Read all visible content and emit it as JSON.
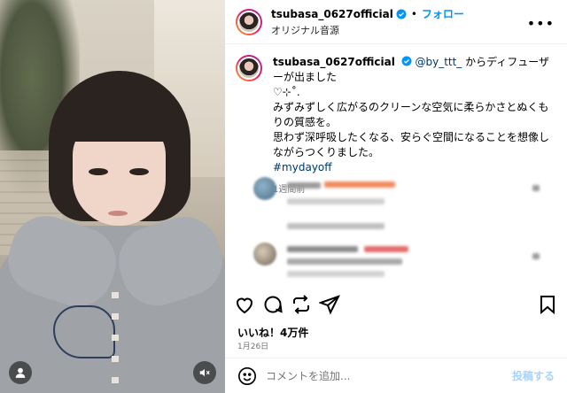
{
  "header": {
    "username": "tsubasa_0627official",
    "separator": "•",
    "follow_label": "フォロー",
    "audio_label": "オリジナル音源",
    "more_label": "•••"
  },
  "caption": {
    "username": "tsubasa_0627official",
    "mention": "@by_ttt_",
    "line1_rest": " からディフューザーが出ました",
    "line2": "♡⊹˚.",
    "line3": "みずみずしく広がるのクリーンな空気に柔らかさとぬくもりの質感を。",
    "line4": "思わず深呼吸したくなる、安らぐ空間になることを想像しながらつくりました。",
    "hashtag": "#mydayoff",
    "time": "1週間前"
  },
  "likes": "いいね！4万件",
  "date": "1月26日",
  "comment_box": {
    "placeholder": "コメントを追加...",
    "post_label": "投稿する"
  },
  "icons": {
    "like": "heart-icon",
    "comment": "comment-icon",
    "share": "repost-icon",
    "send": "send-icon",
    "save": "bookmark-icon",
    "emoji": "emoji-icon",
    "mute": "mute-icon",
    "user": "user-icon"
  },
  "colors": {
    "accent": "#0095f6",
    "verified": "#0095f6",
    "mention": "#00376b",
    "muted": "#737373",
    "post_disabled": "#a8d3f7"
  }
}
